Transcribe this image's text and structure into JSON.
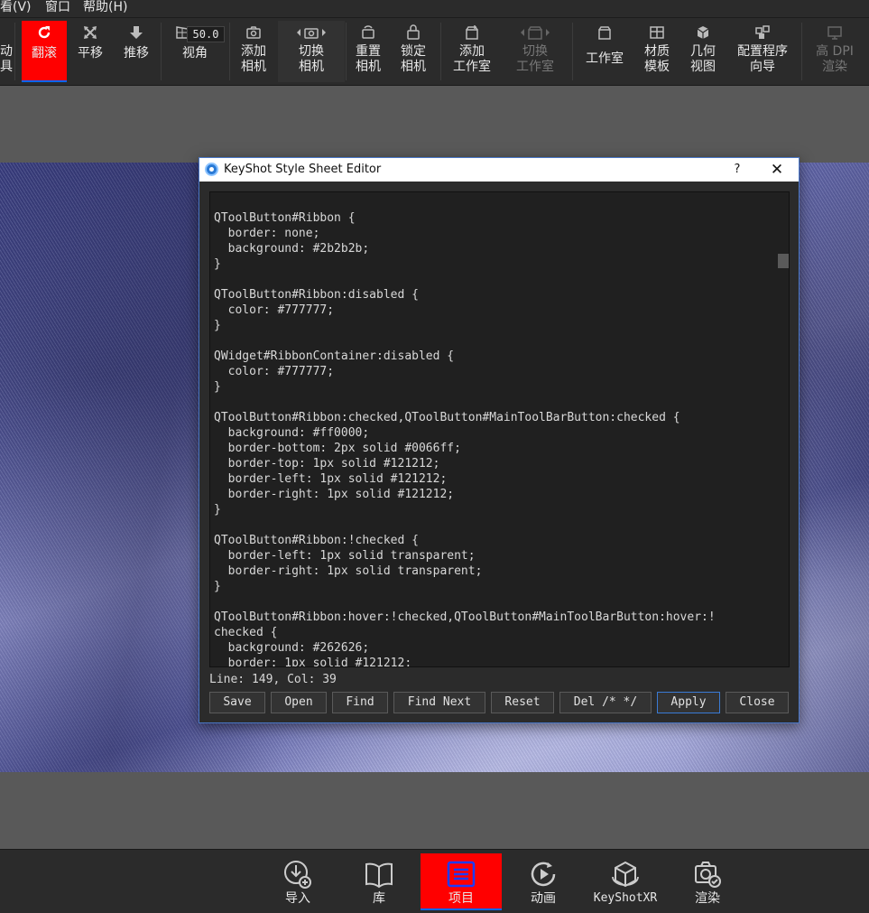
{
  "menubar": {
    "items": [
      "看(V)",
      "窗口",
      "帮助(H)"
    ]
  },
  "ribbon": {
    "partial": {
      "top": "动",
      "bottom": "具"
    },
    "buttons": [
      {
        "label": "翻滚",
        "icon": "tumble-icon",
        "checked": true
      },
      {
        "label": "平移",
        "icon": "pan-icon"
      },
      {
        "label": "推移",
        "icon": "dolly-icon"
      },
      {
        "label": "视角",
        "icon": "perspective-icon"
      },
      {
        "label": "添加\n相机",
        "icon": "add-camera-icon"
      },
      {
        "label": "切换\n相机",
        "icon": "switch-camera-icon"
      },
      {
        "label": "重置\n相机",
        "icon": "reset-camera-icon"
      },
      {
        "label": "锁定\n相机",
        "icon": "lock-camera-icon"
      },
      {
        "label": "添加\n工作室",
        "icon": "add-studio-icon"
      },
      {
        "label": "切换\n工作室",
        "icon": "switch-studio-icon",
        "disabled": true
      },
      {
        "label": "工作室",
        "icon": "studio-icon"
      },
      {
        "label": "材质\n模板",
        "icon": "material-template-icon"
      },
      {
        "label": "几何\n视图",
        "icon": "geometry-view-icon"
      },
      {
        "label": "配置程序\n向导",
        "icon": "configurator-wizard-icon"
      },
      {
        "label": "高 DPI\n渲染",
        "icon": "high-dpi-icon",
        "disabled": true
      }
    ],
    "fov_value": "50.0"
  },
  "dialog": {
    "title": "KeyShot Style Sheet Editor",
    "help": "?",
    "close": "✕",
    "code": "QToolButton#Ribbon {\n  border: none;\n  background: #2b2b2b;\n}\n\nQToolButton#Ribbon:disabled {\n  color: #777777;\n}\n\nQWidget#RibbonContainer:disabled {\n  color: #777777;\n}\n\nQToolButton#Ribbon:checked,QToolButton#MainToolBarButton:checked {\n  background: #ff0000;\n  border-bottom: 2px solid #0066ff;\n  border-top: 1px solid #121212;\n  border-left: 1px solid #121212;\n  border-right: 1px solid #121212;\n}\n\nQToolButton#Ribbon:!checked {\n  border-left: 1px solid transparent;\n  border-right: 1px solid transparent;\n}\n\nQToolButton#Ribbon:hover:!checked,QToolButton#MainToolBarButton:hover:!\nchecked {\n  background: #262626;\n  border: 1px solid #121212;",
    "status": "Line: 149, Col: 39",
    "buttons": {
      "save": "Save",
      "open": "Open",
      "find": "Find",
      "find_next": "Find Next",
      "reset": "Reset",
      "del_comment": "Del /* */",
      "apply": "Apply",
      "close": "Close"
    }
  },
  "bottombar": {
    "items": [
      {
        "label": "导入",
        "icon": "import-icon"
      },
      {
        "label": "库",
        "icon": "library-icon"
      },
      {
        "label": "项目",
        "icon": "project-icon",
        "checked": true
      },
      {
        "label": "动画",
        "icon": "animation-icon"
      },
      {
        "label": "KeyShotXR",
        "icon": "keyshotxr-icon"
      },
      {
        "label": "渲染",
        "icon": "render-icon"
      }
    ]
  },
  "colors": {
    "ribbon_bg": "#2b2b2b",
    "checked_bg": "#ff0000",
    "checked_border": "#0066ff",
    "disabled_text": "#777777"
  }
}
